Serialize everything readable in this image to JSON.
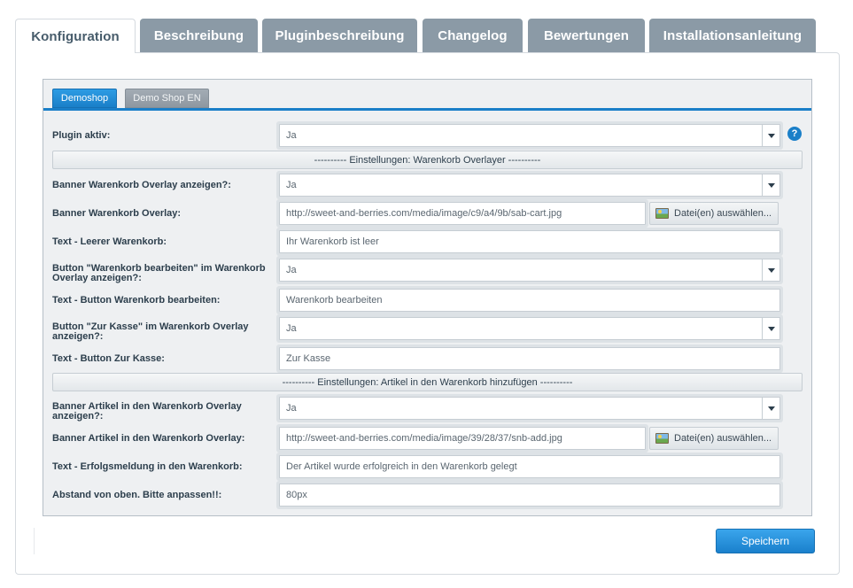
{
  "top_tabs": [
    {
      "label": "Konfiguration",
      "active": true
    },
    {
      "label": "Beschreibung",
      "active": false
    },
    {
      "label": "Pluginbeschreibung",
      "active": false
    },
    {
      "label": "Changelog",
      "active": false
    },
    {
      "label": "Bewertungen",
      "active": false
    },
    {
      "label": "Installationsanleitung",
      "active": false
    }
  ],
  "shop_tabs": [
    {
      "label": "Demoshop",
      "active": true
    },
    {
      "label": "Demo Shop EN",
      "active": false
    }
  ],
  "form": {
    "plugin_active": {
      "label": "Plugin aktiv:",
      "value": "Ja"
    },
    "help_icon": "?",
    "section1": "---------- Einstellungen: Warenkorb Overlayer ----------",
    "banner_cart_show": {
      "label": "Banner Warenkorb Overlay anzeigen?:",
      "value": "Ja"
    },
    "banner_cart": {
      "label": "Banner Warenkorb Overlay:",
      "value": "http://sweet-and-berries.com/media/image/c9/a4/9b/sab-cart.jpg",
      "button": "Datei(en) auswählen..."
    },
    "empty_cart_text": {
      "label": "Text - Leerer Warenkorb:",
      "value": "Ihr Warenkorb ist leer"
    },
    "edit_button_show": {
      "label": "Button \"Warenkorb bearbeiten\" im Warenkorb Overlay anzeigen?:",
      "value": "Ja"
    },
    "edit_button_text": {
      "label": "Text - Button Warenkorb bearbeiten:",
      "value": "Warenkorb bearbeiten"
    },
    "checkout_button_show": {
      "label": "Button \"Zur Kasse\" im Warenkorb Overlay anzeigen?:",
      "value": "Ja"
    },
    "checkout_button_text": {
      "label": "Text - Button Zur Kasse:",
      "value": "Zur Kasse"
    },
    "section2": "---------- Einstellungen: Artikel in den Warenkorb hinzufügen ----------",
    "banner_add_show": {
      "label": "Banner Artikel in den Warenkorb Overlay anzeigen?:",
      "value": "Ja"
    },
    "banner_add": {
      "label": "Banner Artikel in den Warenkorb Overlay:",
      "value": "http://sweet-and-berries.com/media/image/39/28/37/snb-add.jpg",
      "button": "Datei(en) auswählen..."
    },
    "success_text": {
      "label": "Text - Erfolgsmeldung in den Warenkorb:",
      "value": "Der Artikel wurde erfolgreich in den Warenkorb gelegt"
    },
    "top_offset": {
      "label": "Abstand von oben. Bitte anpassen!!:",
      "value": "80px"
    }
  },
  "save_label": "Speichern",
  "colors": {
    "accent": "#1a7fc8",
    "tab_inactive": "#8b9aa6"
  }
}
